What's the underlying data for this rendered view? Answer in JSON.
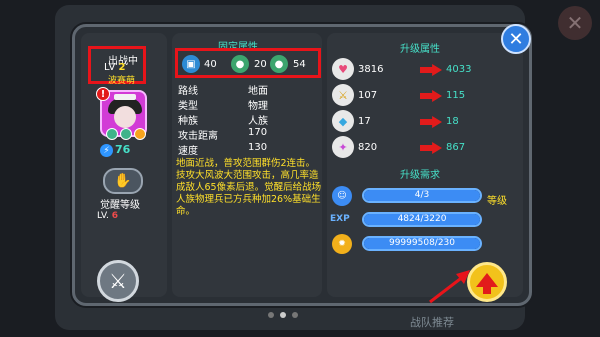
{
  "background": {
    "close_glyph": "✕",
    "bottom_text": "战队推荐"
  },
  "dialog": {
    "close_glyph": "✕"
  },
  "hero": {
    "status": "出战中",
    "level_prefix": "LV",
    "level": "2",
    "name": "波赛萌",
    "warning_glyph": "!",
    "power_icon_glyph": "⚡",
    "power": "76",
    "awaken_label": "觉醒等级",
    "awaken_lv_prefix": "LV.",
    "awaken_lv": "6",
    "awaken_icon_glyph": "✋",
    "sword_icon_glyph": "⚔"
  },
  "fixed_attrs": {
    "title": "固定属性",
    "badges": [
      {
        "icon": "robot-icon",
        "glyph": "▣",
        "value": "40"
      },
      {
        "icon": "person-icon",
        "glyph": "●",
        "value": "20"
      },
      {
        "icon": "person-icon",
        "glyph": "●",
        "value": "54"
      }
    ],
    "rows": [
      {
        "key": "路线",
        "value": "地面"
      },
      {
        "key": "类型",
        "value": "物理"
      },
      {
        "key": "种族",
        "value": "人族"
      },
      {
        "key": "攻击距离",
        "value": "170"
      },
      {
        "key": "速度",
        "value": "130"
      }
    ],
    "description": "地面近战，普攻范围群伤2连击。技攻大风波大范围攻击，高几率造成敌人65像素后退。觉醒后给战场人族物理兵已方兵种加26%基础生命。"
  },
  "upgrade_attrs": {
    "title": "升级属性",
    "rows": [
      {
        "icon": "heart-icon",
        "glyph": "♥",
        "color": "#e84a7a",
        "current": "3816",
        "next": "4033"
      },
      {
        "icon": "sword-icon",
        "glyph": "⚔",
        "color": "#d9a21a",
        "current": "107",
        "next": "115"
      },
      {
        "icon": "shield-icon",
        "glyph": "◆",
        "color": "#36a8e0",
        "current": "17",
        "next": "18"
      },
      {
        "icon": "magic-shield-icon",
        "glyph": "✦",
        "color": "#c84ad6",
        "current": "820",
        "next": "867"
      }
    ]
  },
  "requirements": {
    "title": "升级需求",
    "level_label": "等级",
    "exp_tag": "EXP",
    "bars": [
      {
        "icon": "face-icon",
        "glyph": "☺",
        "color": "#3c8cf4",
        "text": "4/3",
        "fill": 1.0
      },
      {
        "icon": "exp-icon",
        "glyph": "",
        "color": "#3c8cf4",
        "text": "4824/3220",
        "fill": 1.0
      },
      {
        "icon": "coin-icon",
        "glyph": "✹",
        "color": "#f2b01b",
        "text": "99999508/230",
        "fill": 1.0
      }
    ]
  },
  "pagination": {
    "count": 3,
    "active": 1
  }
}
